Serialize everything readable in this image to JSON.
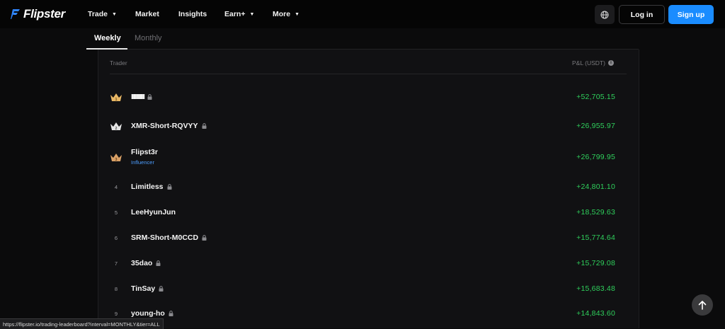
{
  "brand": {
    "name": "Flipster"
  },
  "nav": {
    "items": [
      {
        "label": "Trade",
        "has_dropdown": true
      },
      {
        "label": "Market",
        "has_dropdown": false
      },
      {
        "label": "Insights",
        "has_dropdown": false
      },
      {
        "label": "Earn+",
        "has_dropdown": true
      },
      {
        "label": "More",
        "has_dropdown": true
      }
    ],
    "login_label": "Log in",
    "signup_label": "Sign up",
    "globe_icon": "globe-icon"
  },
  "tabs": {
    "weekly": "Weekly",
    "monthly": "Monthly",
    "active": "Weekly"
  },
  "table": {
    "col_trader": "Trader",
    "col_pnl": "P&L (USDT)",
    "rows": [
      {
        "rank": "1",
        "rank_icon": "gold-crown-icon",
        "name": "IIIIIIIIIIIII",
        "locked": true,
        "pnl": "+52,705.15"
      },
      {
        "rank": "2",
        "rank_icon": "silver-crown-icon",
        "name": "XMR-Short-RQVYY",
        "locked": true,
        "pnl": "+26,955.97"
      },
      {
        "rank": "3",
        "rank_icon": "bronze-crown-icon",
        "name": "Flipst3r",
        "tag": "Influencer",
        "locked": false,
        "pnl": "+26,799.95"
      },
      {
        "rank": "4",
        "name": "Limitless",
        "locked": true,
        "pnl": "+24,801.10"
      },
      {
        "rank": "5",
        "name": "LeeHyunJun",
        "locked": false,
        "pnl": "+18,529.63"
      },
      {
        "rank": "6",
        "name": "SRM-Short-M0CCD",
        "locked": true,
        "pnl": "+15,774.64"
      },
      {
        "rank": "7",
        "name": "35dao",
        "locked": true,
        "pnl": "+15,729.08"
      },
      {
        "rank": "8",
        "name": "TinSay",
        "locked": true,
        "pnl": "+15,683.48"
      },
      {
        "rank": "9",
        "name": "young-ho",
        "locked": true,
        "pnl": "+14,843.60"
      }
    ]
  },
  "status_bar": {
    "url": "https://flipster.io/trading-leaderboard?interval=MONTHLY&tier=ALL"
  },
  "colors": {
    "accent": "#1a8cff",
    "profit": "#2fd05c",
    "influencer": "#4d9eff",
    "gold": "#e8b765",
    "silver": "#e6e6e6",
    "bronze": "#d9a066"
  }
}
